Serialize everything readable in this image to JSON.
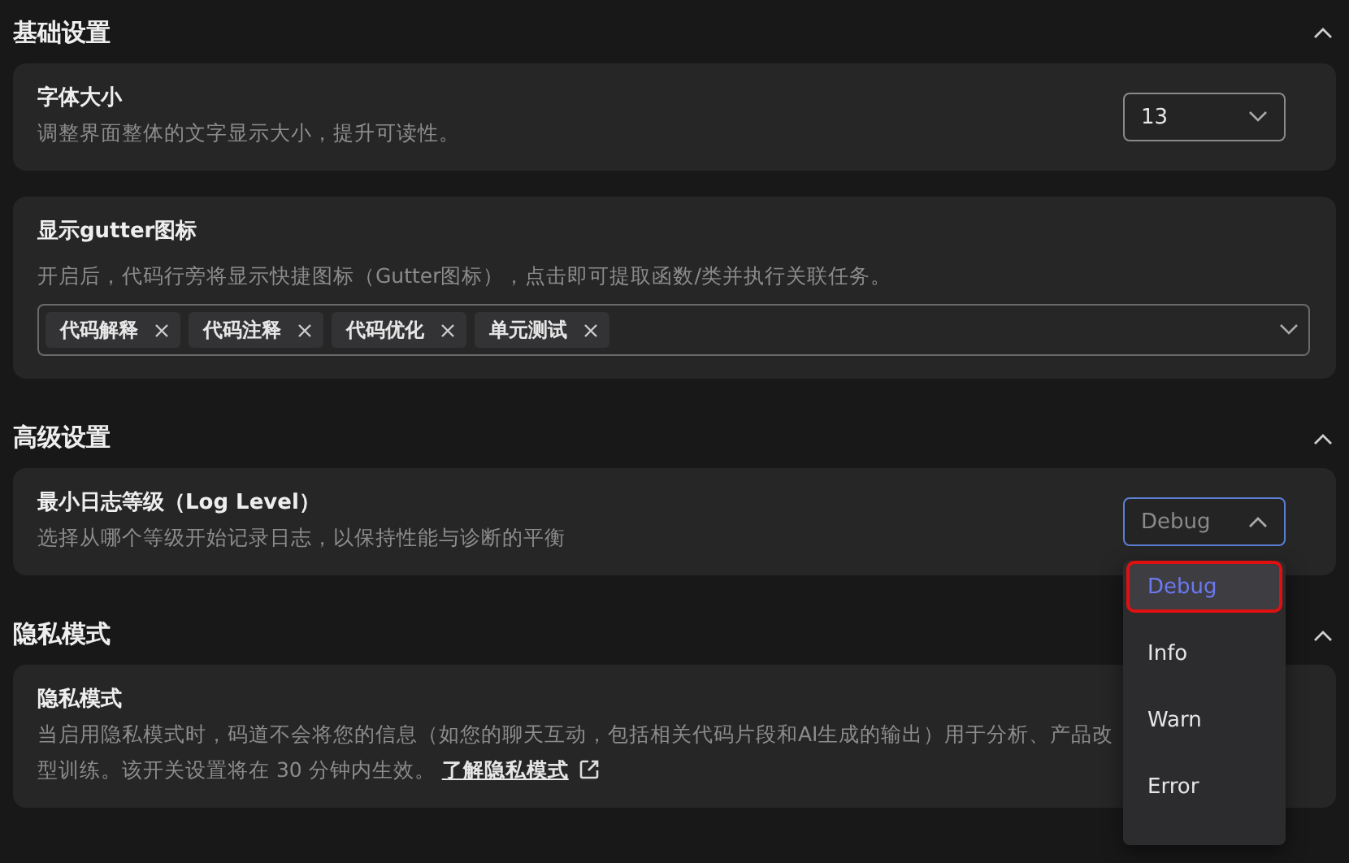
{
  "sections": [
    {
      "title": "基础设置",
      "expanded": true,
      "cards": [
        {
          "kind": "select",
          "title": "字体大小",
          "description": "调整界面整体的文字显示大小，提升可读性。",
          "select": {
            "value": "13",
            "open": false
          }
        },
        {
          "kind": "tags",
          "title": "显示gutter图标",
          "description": "开启后，代码行旁将显示快捷图标（Gutter图标），点击即可提取函数/类并执行关联任务。",
          "tags": [
            "代码解释",
            "代码注释",
            "代码优化",
            "单元测试"
          ]
        }
      ]
    },
    {
      "title": "高级设置",
      "expanded": true,
      "cards": [
        {
          "kind": "select",
          "title": "最小日志等级（Log Level）",
          "description": "选择从哪个等级开始记录日志，以保持性能与诊断的平衡",
          "select": {
            "value": "Debug",
            "open": true,
            "options": [
              {
                "label": "Debug",
                "selected": true,
                "marked": true
              },
              {
                "label": "Info",
                "selected": false,
                "marked": false
              },
              {
                "label": "Warn",
                "selected": false,
                "marked": false
              },
              {
                "label": "Error",
                "selected": false,
                "marked": false
              }
            ]
          }
        }
      ]
    },
    {
      "title": "隐私模式",
      "expanded": true,
      "cards": [
        {
          "kind": "text",
          "title": "隐私模式",
          "lines": [
            "当启用隐私模式时，码道不会将您的信息（如您的聊天互动，包括相关代码片段和AI生成的输出）用于分析、产品改",
            "型训练。该开关设置将在 30 分钟内生效。"
          ],
          "link": "了解隐私模式"
        }
      ]
    }
  ]
}
